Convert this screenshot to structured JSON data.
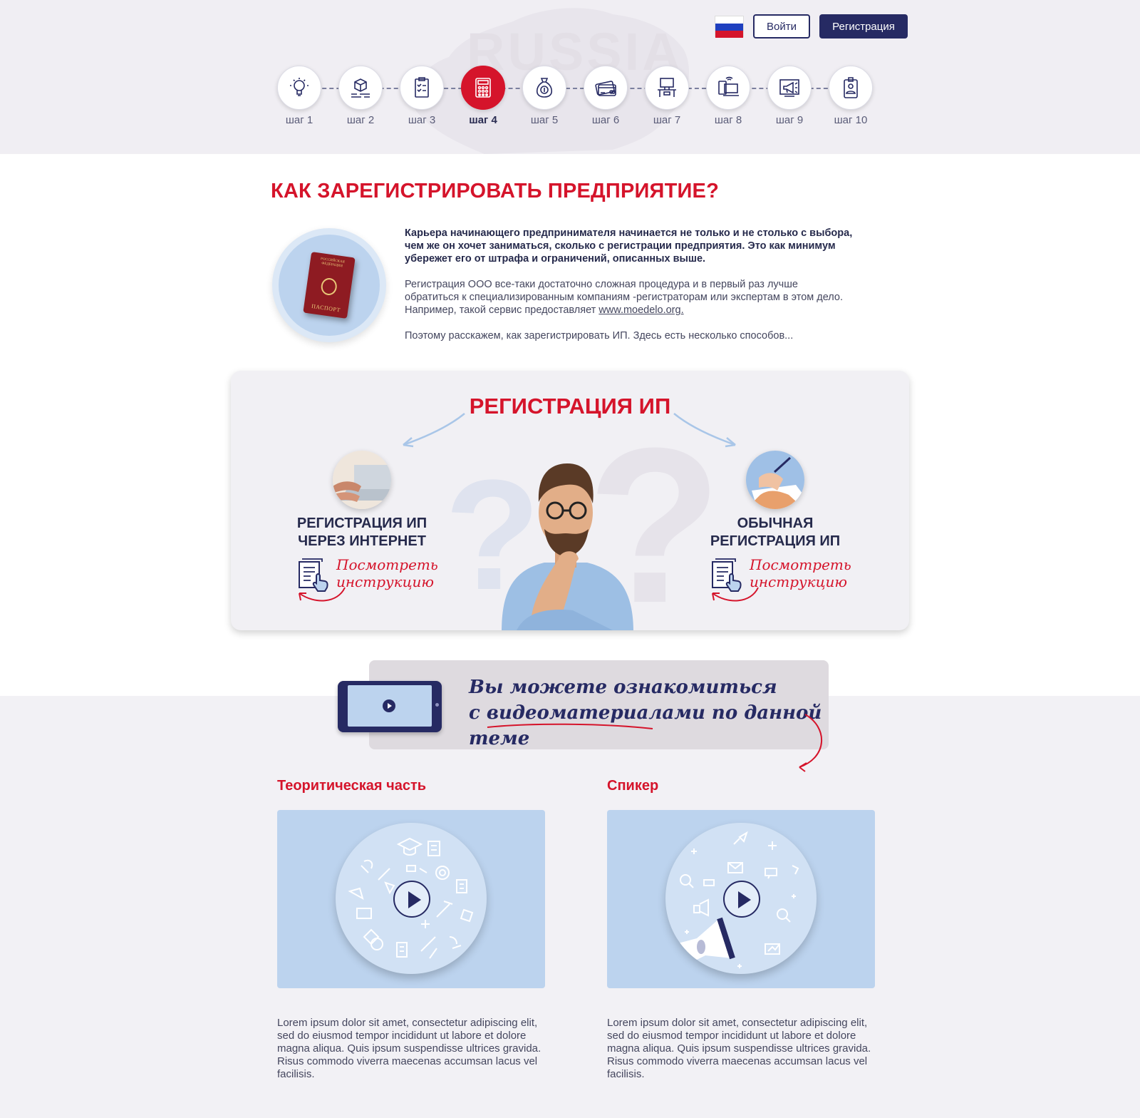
{
  "header": {
    "watermark": "RUSSIA",
    "login_label": "Войти",
    "register_label": "Регистрация",
    "flag_colors": [
      "#ffffff",
      "#1f3fbf",
      "#d5142b"
    ]
  },
  "steps": [
    {
      "label": "шаг 1",
      "icon": "lightbulb-icon",
      "active": false
    },
    {
      "label": "шаг 2",
      "icon": "box-icon",
      "active": false
    },
    {
      "label": "шаг 3",
      "icon": "checklist-icon",
      "active": false
    },
    {
      "label": "шаг 4",
      "icon": "calculator-icon",
      "active": true
    },
    {
      "label": "шаг 5",
      "icon": "money-bag-icon",
      "active": false
    },
    {
      "label": "шаг 6",
      "icon": "credit-card-icon",
      "active": false
    },
    {
      "label": "шаг 7",
      "icon": "workplace-icon",
      "active": false
    },
    {
      "label": "шаг 8",
      "icon": "devices-icon",
      "active": false
    },
    {
      "label": "шаг 9",
      "icon": "megaphone-icon",
      "active": false
    },
    {
      "label": "шаг 10",
      "icon": "id-badge-icon",
      "active": false
    }
  ],
  "intro": {
    "title": "КАК ЗАРЕГИСТРИРОВАТЬ ПРЕДПРИЯТИЕ?",
    "passport_top": "РОССИЙСКАЯ ФЕДЕРАЦИЯ",
    "passport_bottom": "ПАСПОРТ",
    "paragraph_bold": "Карьера начинающего предпринимателя начинается не только и не столько с выбора, чем же он хочет заниматься, сколько с регистрации предприятия. Это как минимум убережет его от штрафа и ограничений, описанных выше.",
    "paragraph_2_text": "Регистрация ООО все-таки достаточно сложная процедура и в первый раз лучше обратиться к специализированным компаниям -регистраторам или экспертам в этом дело. Например, такой сервис предоставляет ",
    "paragraph_2_link": "www.moedelo.org.",
    "paragraph_3": "Поэтому расскажем, как зарегистрировать ИП. Здесь есть несколько способов..."
  },
  "registration": {
    "title": "РЕГИСТРАЦИЯ ИП",
    "option_online": {
      "title_line1": "РЕГИСТРАЦИЯ ИП",
      "title_line2": "ЧЕРЕЗ ИНТЕРНЕТ",
      "link_line1": "Посмотреть",
      "link_line2": "инструкцию"
    },
    "option_regular": {
      "title_line1": "ОБЫЧНАЯ",
      "title_line2": "РЕГИСТРАЦИЯ ИП",
      "link_line1": "Посмотреть",
      "link_line2": "инструкцию"
    }
  },
  "videos": {
    "banner_line1": "Вы можете ознакомиться",
    "banner_line2": "с видеоматериалами по данной теме",
    "items": [
      {
        "title": "Теоритическая часть",
        "description": "Lorem ipsum dolor sit amet, consectetur adipiscing elit, sed do eiusmod tempor incididunt ut labore et dolore magna aliqua. Quis ipsum suspendisse ultrices gravida. Risus commodo viverra maecenas accumsan lacus vel facilisis."
      },
      {
        "title": "Спикер",
        "description": "Lorem ipsum dolor sit amet, consectetur adipiscing elit, sed do eiusmod tempor incididunt ut labore et dolore magna aliqua. Quis ipsum suspendisse ultrices gravida. Risus commodo viverra maecenas accumsan lacus vel facilisis."
      }
    ]
  },
  "colors": {
    "accent_red": "#d5142b",
    "navy": "#262a63",
    "light_blue": "#bcd3ee"
  }
}
